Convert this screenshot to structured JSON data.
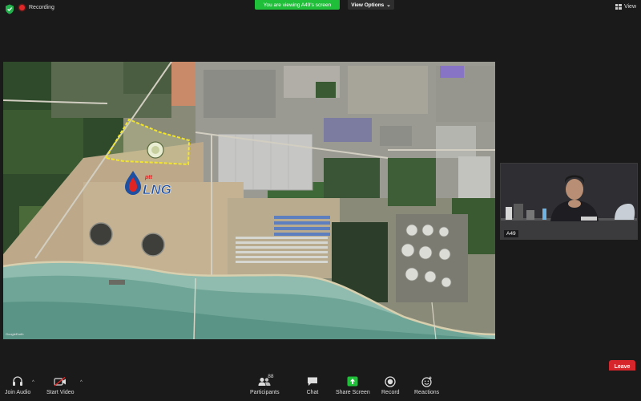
{
  "topbar": {
    "recording_label": "Recording",
    "viewing_banner": "You are viewing A49's screen",
    "view_options_label": "View Options",
    "view_label": "View",
    "colors": {
      "banner_green": "#1fbf3a",
      "record_red": "#e02828",
      "shield_green": "#22b14c"
    }
  },
  "shared_screen": {
    "logo_small": "ptt",
    "logo_large": "LNG",
    "watermark": "GoogleEarth",
    "highlight_color": "#f2e52a"
  },
  "speaker": {
    "name": "A49"
  },
  "toolbar": {
    "join_audio": "Join Audio",
    "start_video": "Start Video",
    "participants": "Participants",
    "participants_count": "88",
    "chat": "Chat",
    "share_screen": "Share Screen",
    "record": "Record",
    "reactions": "Reactions",
    "leave": "Leave",
    "colors": {
      "share_green": "#1fbf3a",
      "leave_red": "#d7262b"
    }
  }
}
